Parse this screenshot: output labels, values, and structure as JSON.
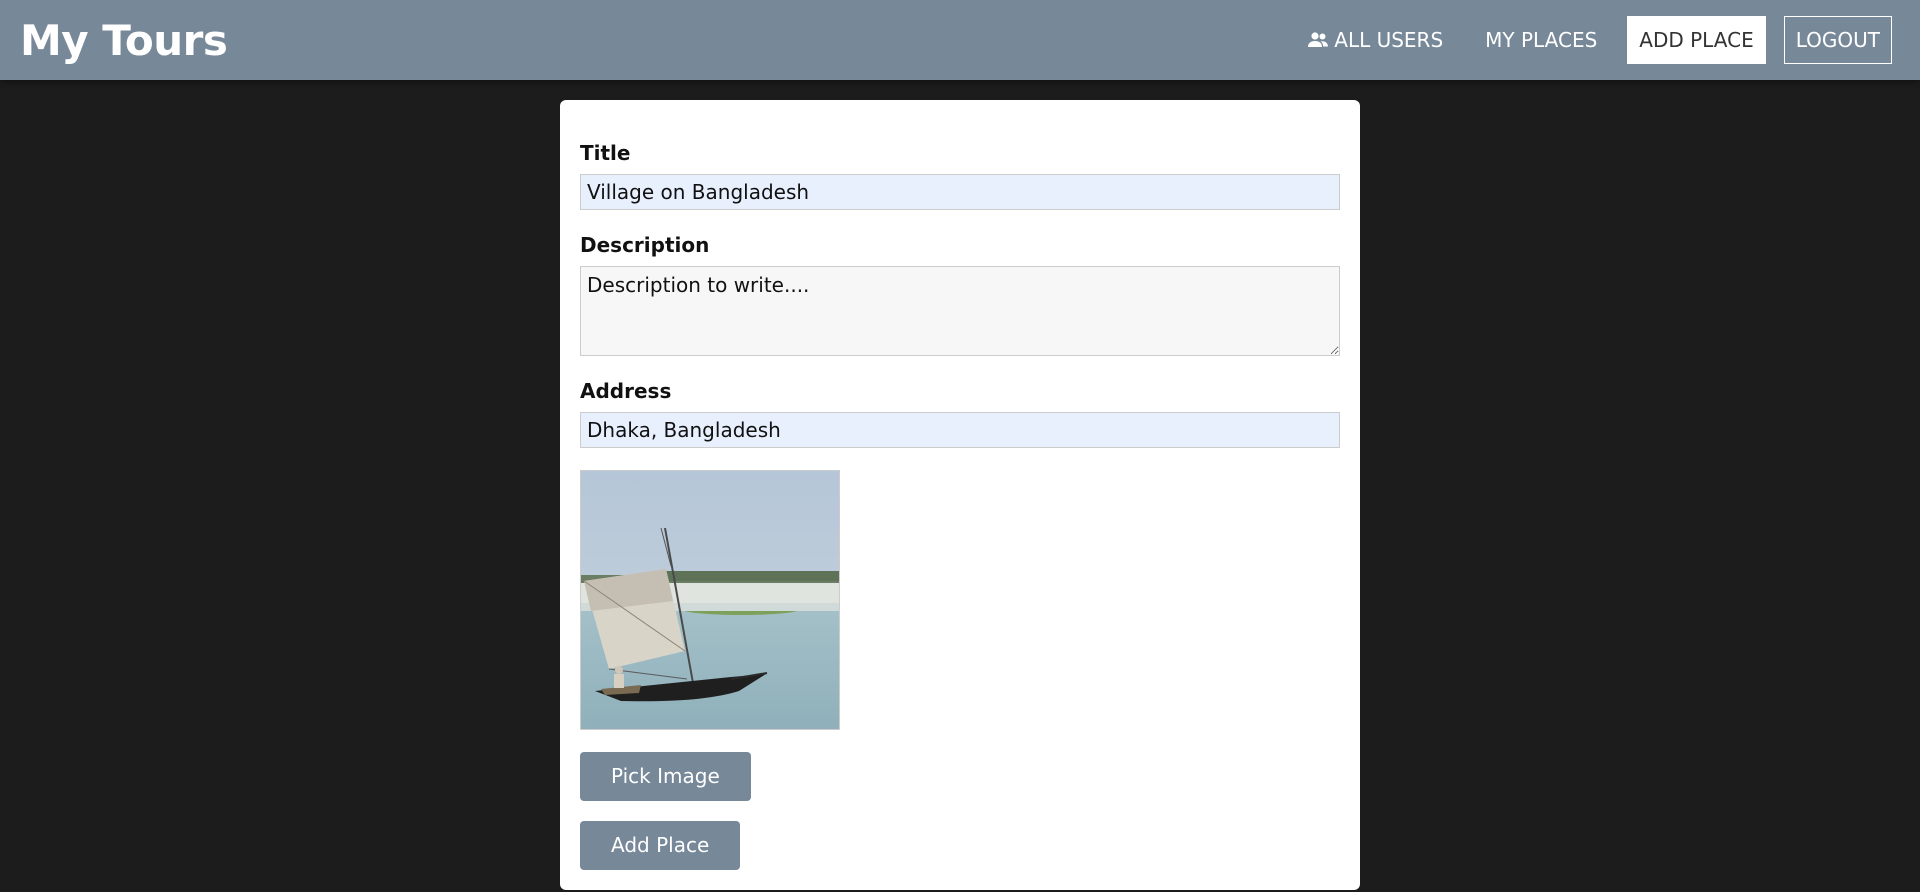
{
  "header": {
    "brand": "My Tours",
    "nav": {
      "all_users": "ALL USERS",
      "my_places": "MY PLACES",
      "add_place": "ADD PLACE",
      "logout": "LOGOUT"
    },
    "icons": {
      "all_users": "users-icon"
    },
    "colors": {
      "bar": "#778899",
      "text": "#ffffff"
    }
  },
  "form": {
    "title_label": "Title",
    "title_value": "Village on Bangladesh",
    "description_label": "Description",
    "description_value": "Description to write....",
    "address_label": "Address",
    "address_value": "Dhaka, Bangladesh",
    "pick_image_label": "Pick Image",
    "submit_label": "Add Place"
  },
  "colors": {
    "page_background": "#1c1c1c",
    "button": "#778899",
    "autofill_input": "#e8f0fe"
  }
}
